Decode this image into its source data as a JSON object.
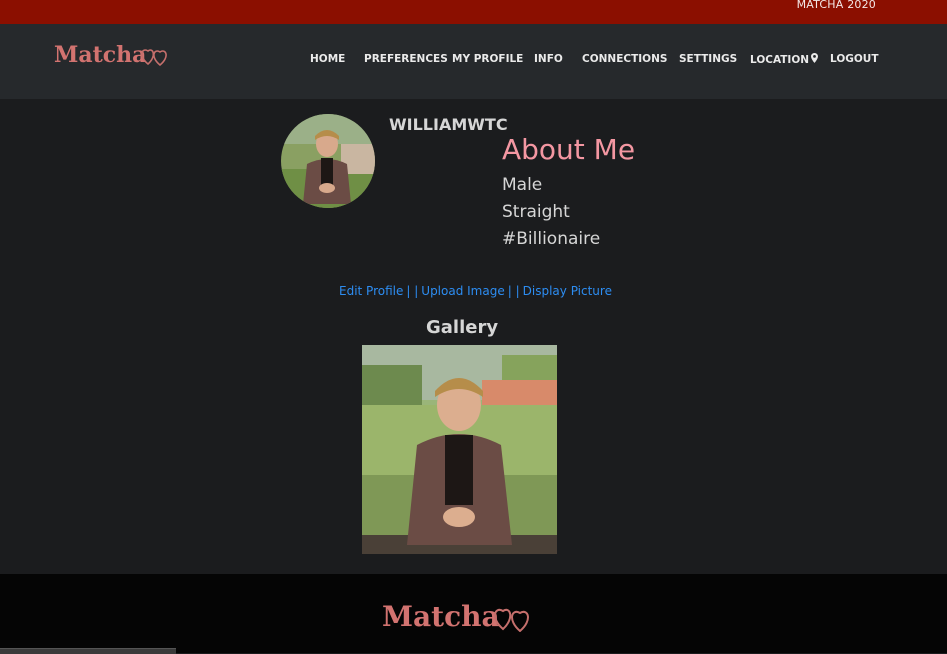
{
  "topbar": {
    "text": "MATCHA 2020"
  },
  "brand": {
    "logo_text": "Matcha",
    "color": "#d27370"
  },
  "nav": {
    "items": [
      {
        "label": "HOME"
      },
      {
        "label": "PREFERENCES"
      },
      {
        "label": "MY PROFILE"
      },
      {
        "label": "INFO"
      },
      {
        "label": "CONNECTIONS"
      },
      {
        "label": "SETTINGS"
      },
      {
        "label": "LOCATION",
        "icon": "map-pin-icon"
      },
      {
        "label": "LOGOUT"
      }
    ]
  },
  "profile": {
    "username": "WILLIAMWTC",
    "about_title": "About Me",
    "gender": "Male",
    "orientation": "Straight",
    "tag": "#Billionaire",
    "links": {
      "edit": "Edit Profile",
      "upload": "Upload Image",
      "display": "Display Picture",
      "separator": "| |"
    },
    "gallery_title": "Gallery"
  },
  "footer": {
    "logo_text": "Matcha"
  },
  "colors": {
    "topbar": "#8b0f00",
    "navbar": "#26292c",
    "background": "#1b1c1e",
    "accent_pink": "#f497a2",
    "link_blue": "#2d8df2",
    "footer": "#050505"
  }
}
